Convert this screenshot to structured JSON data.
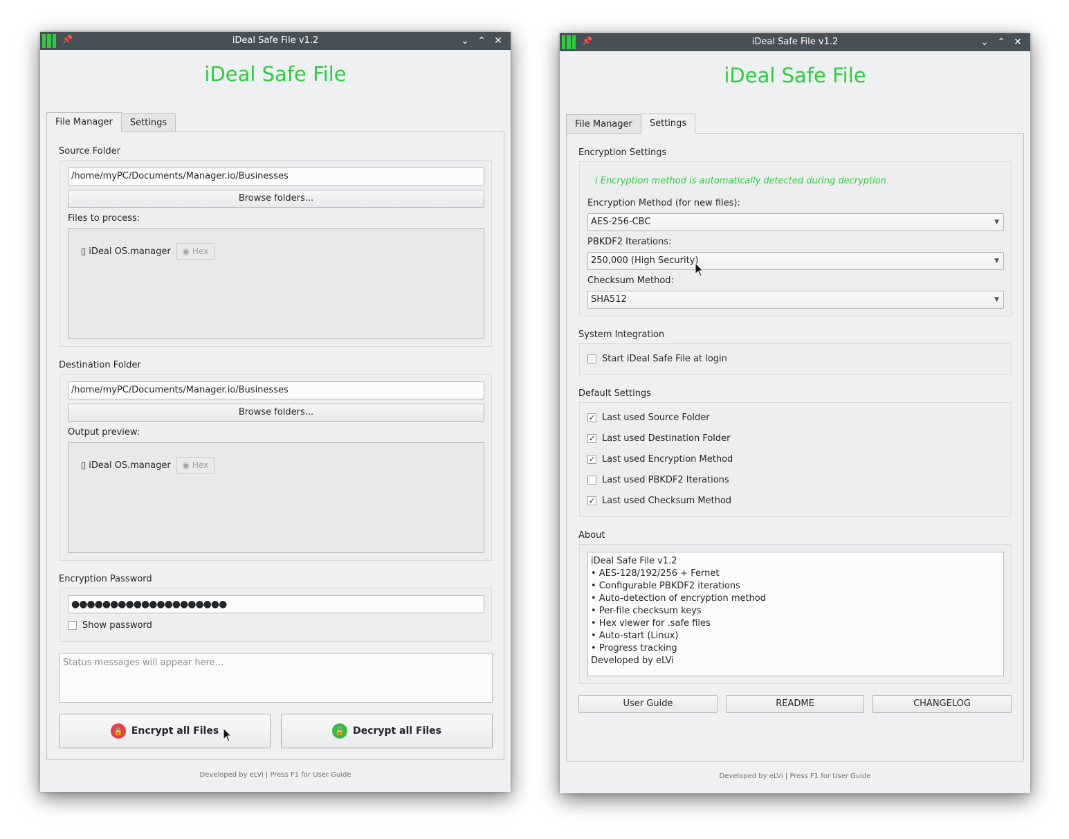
{
  "window_title": "iDeal Safe File v1.2",
  "app_title": "iDeal Safe File",
  "tabs": {
    "file_manager": "File Manager",
    "settings": "Settings"
  },
  "file_manager": {
    "source": {
      "label": "Source Folder",
      "path": "/home/myPC/Documents/Manager.io/Businesses",
      "browse": "Browse folders...",
      "files_label": "Files to process:",
      "item": "▯ iDeal OS.manager",
      "hex": "◉ Hex"
    },
    "destination": {
      "label": "Destination Folder",
      "path": "/home/myPC/Documents/Manager.io/Businesses",
      "browse": "Browse folders...",
      "preview_label": "Output preview:",
      "item": "▯ iDeal OS.manager",
      "hex": "◉ Hex"
    },
    "password": {
      "label": "Encryption Password",
      "value": "●●●●●●●●●●●●●●●●●●●●",
      "show_label": "Show password",
      "show_checked": false
    },
    "status_placeholder": "Status messages will appear here...",
    "encrypt_button": "Encrypt all Files",
    "decrypt_button": "Decrypt all Files"
  },
  "settings": {
    "encryption": {
      "label": "Encryption Settings",
      "info": "i Encryption method is automatically detected during decryption",
      "method_label": "Encryption Method (for new files):",
      "method_value": "AES-256-CBC",
      "iterations_label": "PBKDF2 Iterations:",
      "iterations_value": "250,000 (High Security)",
      "checksum_label": "Checksum Method:",
      "checksum_value": "SHA512"
    },
    "system": {
      "label": "System Integration",
      "autostart_label": "Start iDeal Safe File at login",
      "autostart_checked": false
    },
    "defaults": {
      "label": "Default Settings",
      "items": [
        {
          "label": "Last used Source Folder",
          "checked": true
        },
        {
          "label": "Last used Destination Folder",
          "checked": true
        },
        {
          "label": "Last used Encryption Method",
          "checked": true
        },
        {
          "label": "Last used PBKDF2 Iterations",
          "checked": false
        },
        {
          "label": "Last used Checksum Method",
          "checked": true
        }
      ]
    },
    "about": {
      "label": "About",
      "lines": [
        "iDeal Safe File v1.2",
        "• AES-128/192/256 + Fernet",
        "• Configurable PBKDF2 iterations",
        "• Auto-detection of encryption method",
        "• Per-file checksum keys",
        "• Hex viewer for .safe files",
        "• Auto-start (Linux)",
        "• Progress tracking",
        "Developed by eLVi"
      ]
    },
    "buttons": {
      "user_guide": "User Guide",
      "readme": "README",
      "changelog": "CHANGELOG"
    }
  },
  "footer": "Developed by eLVi | Press F1 for User Guide",
  "colors": {
    "accent_green": "#2ecc40",
    "titlebar": "#475057",
    "window_bg": "#eff0f1"
  }
}
